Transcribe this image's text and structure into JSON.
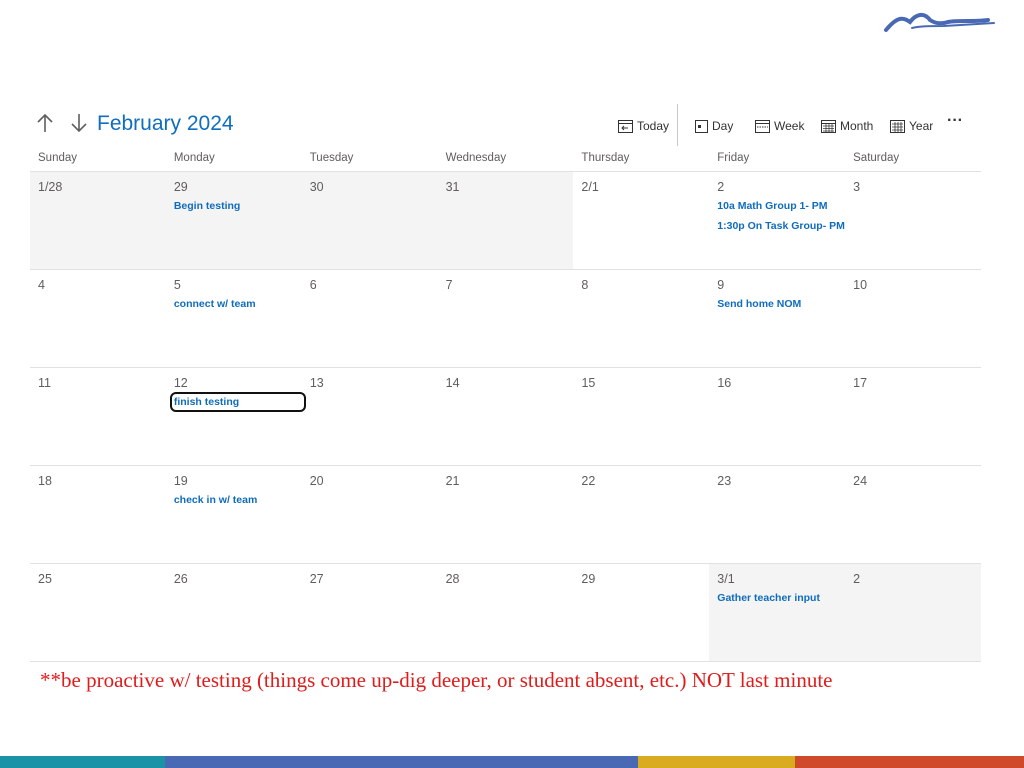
{
  "calendar": {
    "month_title": "February 2024",
    "toolbar": {
      "today": "Today",
      "day": "Day",
      "week": "Week",
      "month": "Month",
      "year": "Year",
      "more": "···"
    },
    "days_of_week": [
      "Sunday",
      "Monday",
      "Tuesday",
      "Wednesday",
      "Thursday",
      "Friday",
      "Saturday"
    ],
    "weeks": [
      [
        {
          "date": "1/28",
          "outside": true,
          "events": []
        },
        {
          "date": "29",
          "outside": true,
          "events": [
            "Begin testing"
          ]
        },
        {
          "date": "30",
          "outside": true,
          "events": []
        },
        {
          "date": "31",
          "outside": true,
          "events": []
        },
        {
          "date": "2/1",
          "outside": false,
          "events": []
        },
        {
          "date": "2",
          "outside": false,
          "events": [
            "10a Math Group 1- PM",
            "1:30p On Task Group- PM"
          ]
        },
        {
          "date": "3",
          "outside": false,
          "events": []
        }
      ],
      [
        {
          "date": "4",
          "outside": false,
          "events": []
        },
        {
          "date": "5",
          "outside": false,
          "events": [
            "connect w/ team"
          ]
        },
        {
          "date": "6",
          "outside": false,
          "events": []
        },
        {
          "date": "7",
          "outside": false,
          "events": []
        },
        {
          "date": "8",
          "outside": false,
          "events": []
        },
        {
          "date": "9",
          "outside": false,
          "events": [
            "Send home NOM"
          ]
        },
        {
          "date": "10",
          "outside": false,
          "events": []
        }
      ],
      [
        {
          "date": "11",
          "outside": false,
          "events": []
        },
        {
          "date": "12",
          "outside": false,
          "events": [
            "finish testing"
          ],
          "selected": true
        },
        {
          "date": "13",
          "outside": false,
          "events": []
        },
        {
          "date": "14",
          "outside": false,
          "events": []
        },
        {
          "date": "15",
          "outside": false,
          "events": []
        },
        {
          "date": "16",
          "outside": false,
          "events": []
        },
        {
          "date": "17",
          "outside": false,
          "events": []
        }
      ],
      [
        {
          "date": "18",
          "outside": false,
          "events": []
        },
        {
          "date": "19",
          "outside": false,
          "events": [
            "check in w/ team"
          ]
        },
        {
          "date": "20",
          "outside": false,
          "events": []
        },
        {
          "date": "21",
          "outside": false,
          "events": []
        },
        {
          "date": "22",
          "outside": false,
          "events": []
        },
        {
          "date": "23",
          "outside": false,
          "events": []
        },
        {
          "date": "24",
          "outside": false,
          "events": []
        }
      ],
      [
        {
          "date": "25",
          "outside": false,
          "events": []
        },
        {
          "date": "26",
          "outside": false,
          "events": []
        },
        {
          "date": "27",
          "outside": false,
          "events": []
        },
        {
          "date": "28",
          "outside": false,
          "events": []
        },
        {
          "date": "29",
          "outside": false,
          "events": []
        },
        {
          "date": "3/1",
          "outside": true,
          "events": [
            "Gather teacher input"
          ]
        },
        {
          "date": "2",
          "outside": true,
          "events": []
        }
      ]
    ]
  },
  "note": "**be proactive w/ testing (things come up-dig deeper, or student absent, etc.) NOT last  minute",
  "colors": {
    "accent": "#106ebe",
    "event_text": "#0f6cbd",
    "note_text": "#e01b1b",
    "footer_segments": [
      "#1a93a6",
      "#4a69b5",
      "#d9ab1e",
      "#cf4a2a"
    ]
  }
}
